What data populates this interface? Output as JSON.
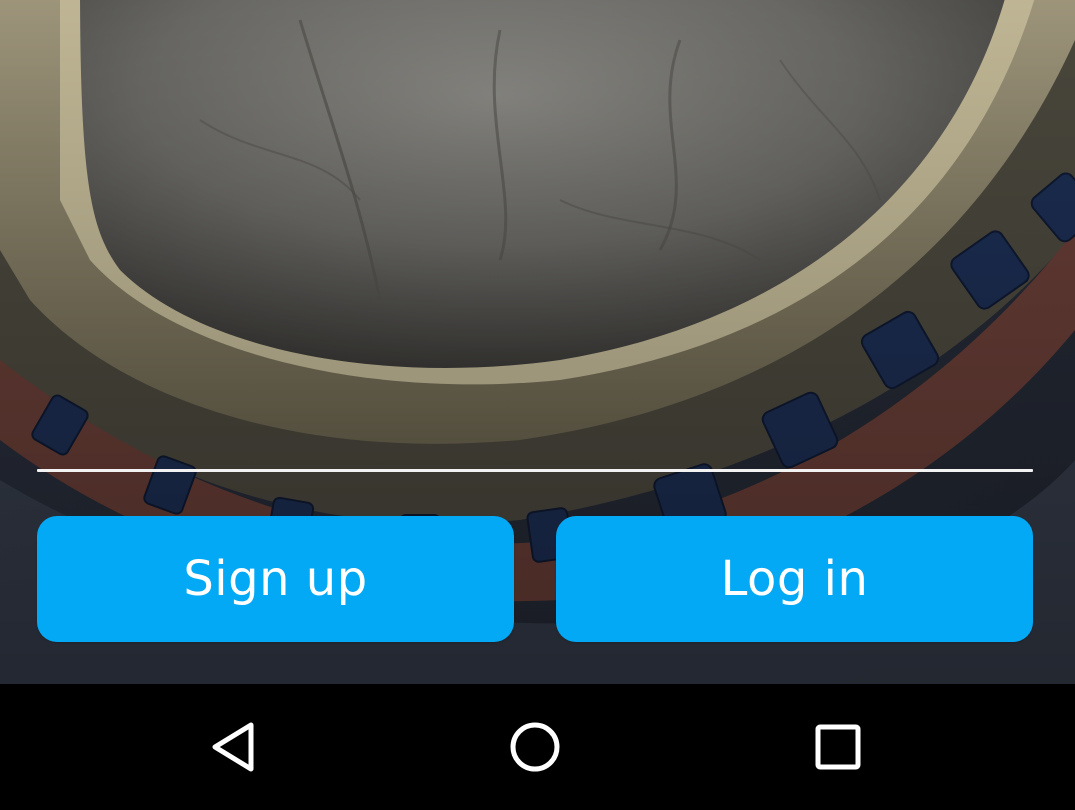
{
  "auth": {
    "signup_label": "Sign up",
    "login_label": "Log in"
  },
  "navigation_bar": {
    "back_icon": "triangle-back-icon",
    "home_icon": "circle-home-icon",
    "recents_icon": "square-recents-icon"
  },
  "colors": {
    "button_bg": "#03a9f4",
    "button_text": "#ffffff",
    "divider": "#f2f2f2",
    "nav_bar_bg": "#000000"
  }
}
